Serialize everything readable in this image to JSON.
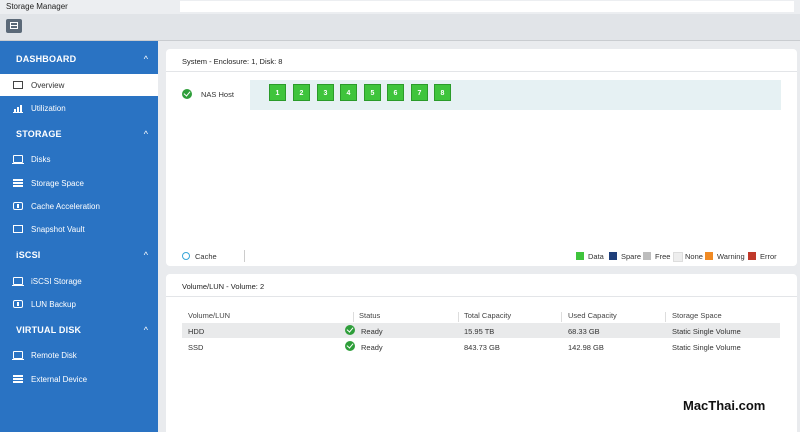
{
  "app": {
    "title": "Storage Manager"
  },
  "sidebar": {
    "sections": [
      {
        "label": "DASHBOARD",
        "chevron": "^"
      },
      {
        "label": "STORAGE",
        "chevron": "^"
      },
      {
        "label": "iSCSI",
        "chevron": "^"
      },
      {
        "label": "VIRTUAL DISK",
        "chevron": "^"
      }
    ],
    "items": [
      {
        "label": "Overview",
        "icon": "overview-icon",
        "active": true
      },
      {
        "label": "Utilization",
        "icon": "chart-bars-icon"
      },
      {
        "label": "Disks",
        "icon": "disk-icon"
      },
      {
        "label": "Storage Space",
        "icon": "stack-icon"
      },
      {
        "label": "Cache Acceleration",
        "icon": "cache-icon"
      },
      {
        "label": "Snapshot Vault",
        "icon": "vault-icon"
      },
      {
        "label": "iSCSI Storage",
        "icon": "iscsi-icon"
      },
      {
        "label": "LUN Backup",
        "icon": "backup-icon"
      },
      {
        "label": "Remote Disk",
        "icon": "remote-disk-icon"
      },
      {
        "label": "External Device",
        "icon": "external-device-icon"
      }
    ]
  },
  "system_panel": {
    "title": "System - Enclosure: 1, Disk: 8",
    "host_label": "NAS Host",
    "disks": [
      "1",
      "2",
      "3",
      "4",
      "5",
      "6",
      "7",
      "8"
    ],
    "cache_label": "Cache",
    "legend": [
      {
        "label": "Data",
        "color": "#3fc43c"
      },
      {
        "label": "Spare",
        "color": "#1f3f7a"
      },
      {
        "label": "Free",
        "color": "#bdbdbd"
      },
      {
        "label": "None",
        "color": "#eeeeee"
      },
      {
        "label": "Warning",
        "color": "#f08a24"
      },
      {
        "label": "Error",
        "color": "#c0392b"
      }
    ]
  },
  "volume_panel": {
    "title": "Volume/LUN - Volume: 2",
    "columns": [
      "Volume/LUN",
      "Status",
      "Total Capacity",
      "Used Capacity",
      "Storage Space"
    ],
    "rows": [
      {
        "name": "HDD",
        "status": "Ready",
        "total": "15.95 TB",
        "used": "68.33 GB",
        "space": "Static Single Volume"
      },
      {
        "name": "SSD",
        "status": "Ready",
        "total": "843.73 GB",
        "used": "142.98 GB",
        "space": "Static Single Volume"
      }
    ]
  },
  "watermark": "MacThai.com"
}
